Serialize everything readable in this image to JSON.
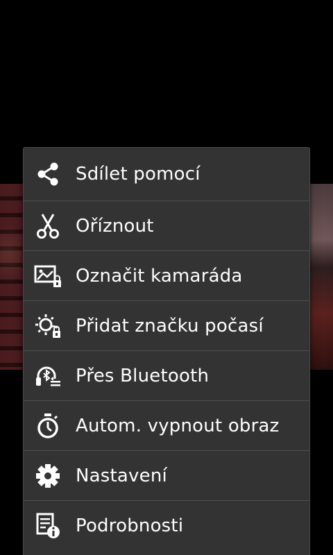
{
  "menu": {
    "items": [
      {
        "label": "Sdílet pomocí",
        "icon": "share-icon"
      },
      {
        "label": "Oříznout",
        "icon": "scissors-icon"
      },
      {
        "label": "Označit kamaráda",
        "icon": "tag-friend-icon"
      },
      {
        "label": "Přidat značku počasí",
        "icon": "weather-tag-icon"
      },
      {
        "label": "Přes Bluetooth",
        "icon": "bluetooth-icon"
      },
      {
        "label": "Autom. vypnout obraz",
        "icon": "timer-icon"
      },
      {
        "label": "Nastavení",
        "icon": "gear-icon"
      },
      {
        "label": "Podrobnosti",
        "icon": "details-icon"
      }
    ]
  },
  "colors": {
    "background": "#000000",
    "menu_background": "#333333",
    "divider": "#4f4f4f",
    "text": "#ffffff"
  }
}
